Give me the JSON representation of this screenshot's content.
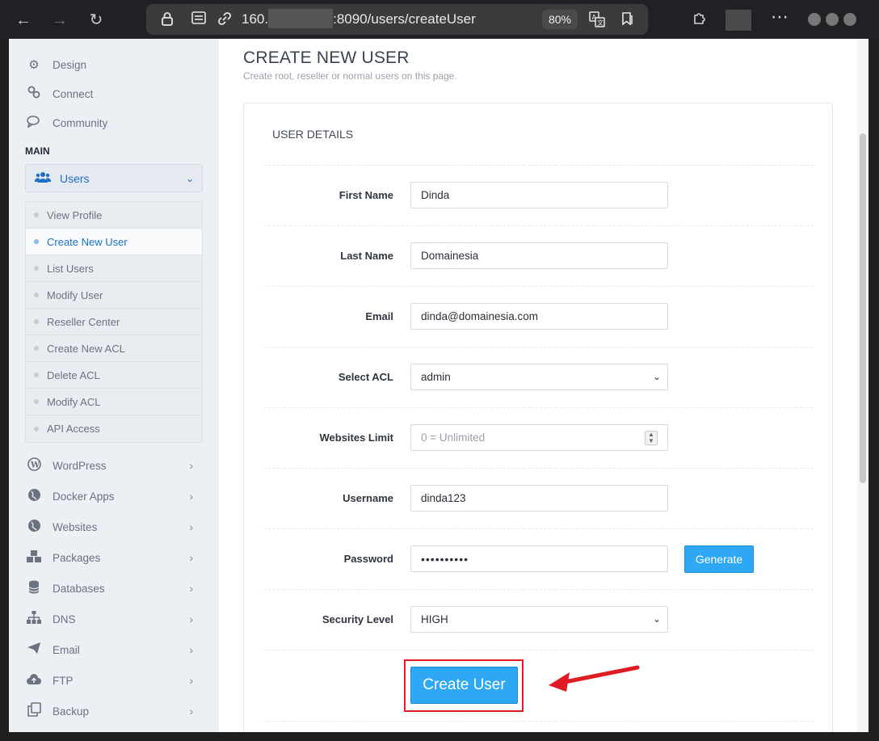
{
  "browser": {
    "url_prefix": "160.",
    "url_suffix": ":8090/users/createUser",
    "zoom": "80%"
  },
  "sidebar": {
    "top_items": [
      {
        "label": "Design",
        "icon": "gear-icon"
      },
      {
        "label": "Connect",
        "icon": "link-icon"
      },
      {
        "label": "Community",
        "icon": "chat-icon"
      }
    ],
    "main_heading": "MAIN",
    "users_label": "Users",
    "users_submenu": [
      {
        "label": "View Profile"
      },
      {
        "label": "Create New User",
        "active": true
      },
      {
        "label": "List Users"
      },
      {
        "label": "Modify User"
      },
      {
        "label": "Reseller Center"
      },
      {
        "label": "Create New ACL"
      },
      {
        "label": "Delete ACL"
      },
      {
        "label": "Modify ACL"
      },
      {
        "label": "API Access"
      }
    ],
    "bottom_items": [
      {
        "label": "WordPress",
        "icon": "wordpress-icon"
      },
      {
        "label": "Docker Apps",
        "icon": "globe-icon"
      },
      {
        "label": "Websites",
        "icon": "globe-icon"
      },
      {
        "label": "Packages",
        "icon": "cubes-icon"
      },
      {
        "label": "Databases",
        "icon": "database-icon"
      },
      {
        "label": "DNS",
        "icon": "sitemap-icon"
      },
      {
        "label": "Email",
        "icon": "paper-plane-icon"
      },
      {
        "label": "FTP",
        "icon": "cloud-upload-icon"
      },
      {
        "label": "Backup",
        "icon": "copy-icon"
      }
    ]
  },
  "page": {
    "title": "CREATE NEW USER",
    "subtitle": "Create root, reseller or normal users on this page.",
    "card_title": "USER DETAILS"
  },
  "form": {
    "first_name": {
      "label": "First Name",
      "value": "Dinda"
    },
    "last_name": {
      "label": "Last Name",
      "value": "Domainesia"
    },
    "email": {
      "label": "Email",
      "value": "dinda@domainesia.com"
    },
    "acl": {
      "label": "Select ACL",
      "value": "admin"
    },
    "websites_limit": {
      "label": "Websites Limit",
      "placeholder": "0 = Unlimited"
    },
    "username": {
      "label": "Username",
      "value": "dinda123"
    },
    "password": {
      "label": "Password",
      "value": "••••••••••"
    },
    "security_level": {
      "label": "Security Level",
      "value": "HIGH"
    },
    "generate_label": "Generate",
    "create_label": "Create User"
  },
  "colors": {
    "accent": "#2ea8f5",
    "active_link": "#1f6fc4",
    "highlight_border": "#e01b24"
  }
}
